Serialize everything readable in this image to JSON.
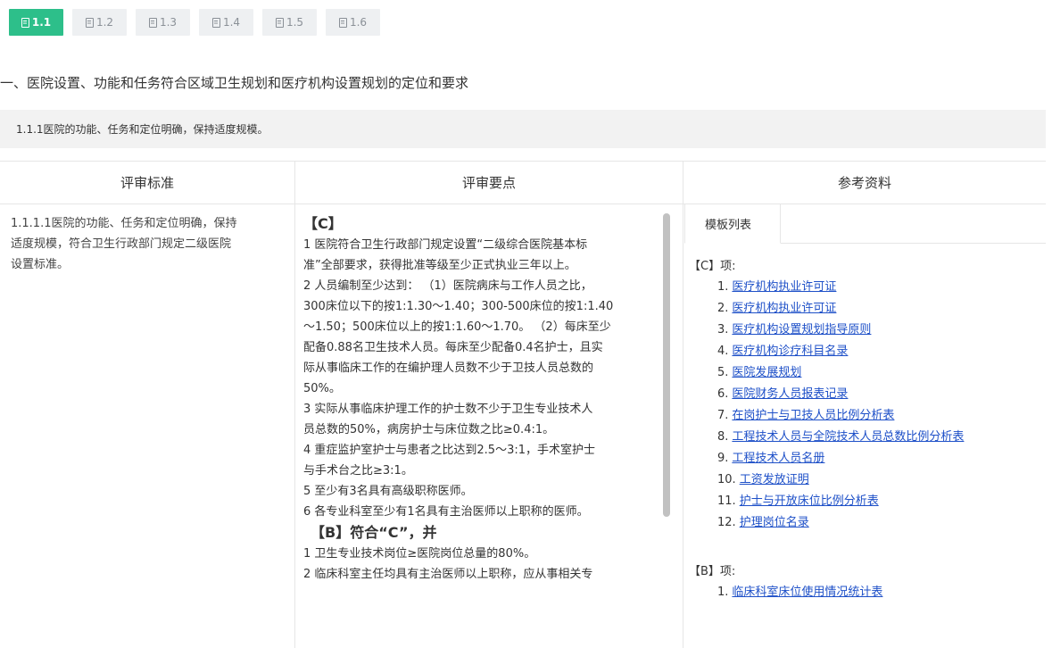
{
  "tabs": [
    {
      "label": "1.1",
      "active": true
    },
    {
      "label": "1.2",
      "active": false
    },
    {
      "label": "1.3",
      "active": false
    },
    {
      "label": "1.4",
      "active": false
    },
    {
      "label": "1.5",
      "active": false
    },
    {
      "label": "1.6",
      "active": false
    }
  ],
  "section_title": "一、医院设置、功能和任务符合区域卫生规划和医疗机构设置规划的定位和要求",
  "subhead": "1.1.1医院的功能、任务和定位明确，保持适度规模。",
  "table": {
    "headers": [
      "评审标准",
      "评审要点",
      "参考资料"
    ],
    "standard_lines": [
      "1.1.1.1医院的功能、任务和定位明确，保持",
      "适度规模，符合卫生行政部门规定二级医院",
      "设置标准。"
    ],
    "points": {
      "grade_c": "【C】",
      "c_lines": [
        "1 医院符合卫生行政部门规定设置“二级综合医院基本标",
        "准”全部要求，获得批准等级至少正式执业三年以上。",
        "2 人员编制至少达到：  （1）医院病床与工作人员之比，",
        "300床位以下的按1:1.30～1.40；300-500床位的按1:1.40",
        "～1.50；500床位以上的按1:1.60～1.70。 （2）每床至少",
        "配备0.88名卫生技术人员。每床至少配备0.4名护士，且实",
        "际从事临床工作的在编护理人员数不少于卫技人员总数的",
        "50%。",
        "3 实际从事临床护理工作的护士数不少于卫生专业技术人",
        "员总数的50%，病房护士与床位数之比≥0.4:1。",
        "4 重症监护室护士与患者之比达到2.5～3:1，手术室护士",
        "与手术台之比≥3:1。",
        "5 至少有3名具有高级职称医师。",
        "6 各专业科室至少有1名具有主治医师以上职称的医师。"
      ],
      "grade_b": "【B】符合“C”，并",
      "b_lines": [
        "1 卫生专业技术岗位≥医院岗位总量的80%。",
        "2 临床科室主任均具有主治医师以上职称，应从事相关专"
      ]
    },
    "references": {
      "tab_label": "模板列表",
      "grade_c_label": "【C】项:",
      "c_items": [
        {
          "num": "1.",
          "text": "医疗机构执业许可证"
        },
        {
          "num": "2.",
          "text": "医疗机构执业许可证"
        },
        {
          "num": "3.",
          "text": "医疗机构设置规划指导原则"
        },
        {
          "num": "4.",
          "text": "医疗机构诊疗科目名录"
        },
        {
          "num": "5.",
          "text": "医院发展规划"
        },
        {
          "num": "6.",
          "text": "医院财务人员报表记录"
        },
        {
          "num": "7.",
          "text": "在岗护士与卫技人员比例分析表"
        },
        {
          "num": "8.",
          "text": "工程技术人员与全院技术人员总数比例分析表"
        },
        {
          "num": "9.",
          "text": "工程技术人员名册"
        },
        {
          "num": "10.",
          "text": "工资发放证明"
        },
        {
          "num": "11.",
          "text": "护士与开放床位比例分析表"
        },
        {
          "num": "12.",
          "text": "护理岗位名录"
        }
      ],
      "grade_b_label": "【B】项:",
      "b_items": [
        {
          "num": "1.",
          "text": "临床科室床位使用情况统计表"
        }
      ]
    }
  },
  "colors": {
    "active_tab": "#2dbf8a",
    "link": "#1e50c8"
  }
}
